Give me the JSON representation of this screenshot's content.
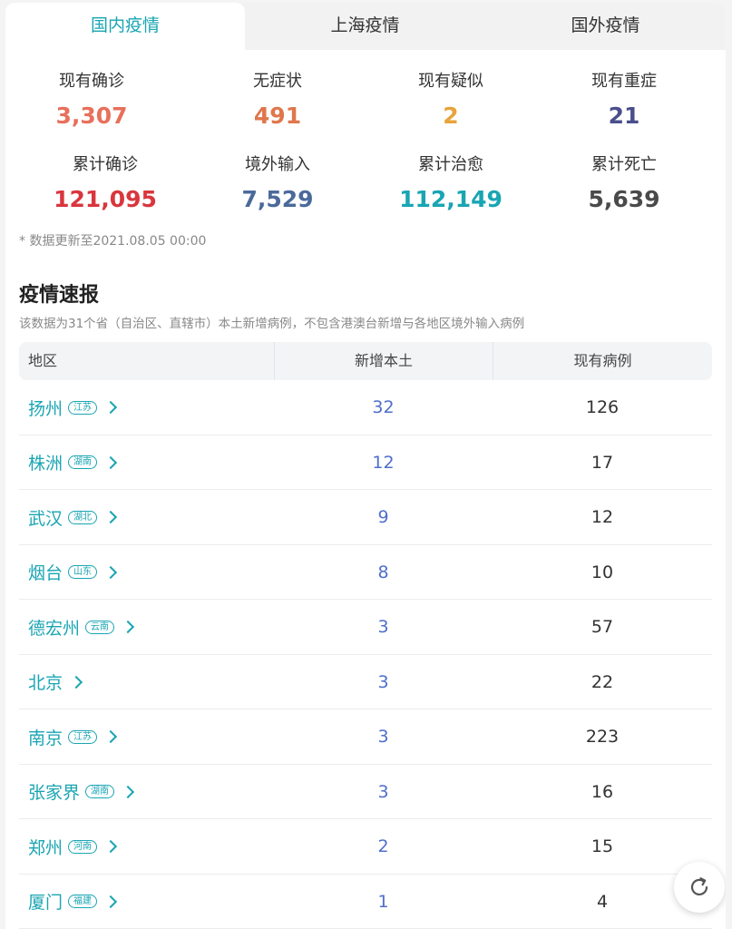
{
  "tabs": [
    {
      "label": "国内疫情",
      "active": true
    },
    {
      "label": "上海疫情",
      "active": false
    },
    {
      "label": "国外疫情",
      "active": false
    }
  ],
  "stats": [
    {
      "label": "现有确诊",
      "value": "3,307",
      "color": "#e8705c"
    },
    {
      "label": "无症状",
      "value": "491",
      "color": "#e0764c"
    },
    {
      "label": "现有疑似",
      "value": "2",
      "color": "#e8a33a"
    },
    {
      "label": "现有重症",
      "value": "21",
      "color": "#4a4f8c"
    },
    {
      "label": "累计确诊",
      "value": "121,095",
      "color": "#d9363e"
    },
    {
      "label": "境外输入",
      "value": "7,529",
      "color": "#4b6a9b"
    },
    {
      "label": "累计治愈",
      "value": "112,149",
      "color": "#1aa5b3"
    },
    {
      "label": "累计死亡",
      "value": "5,639",
      "color": "#4a4a4a"
    }
  ],
  "update_note": "* 数据更新至2021.08.05 00:00",
  "section": {
    "title": "疫情速报",
    "description": "该数据为31个省（自治区、直辖市）本土新增病例，不包含港澳台新增与各地区境外输入病例"
  },
  "table": {
    "headers": {
      "region": "地区",
      "new_local": "新增本土",
      "current": "现有病例"
    },
    "rows": [
      {
        "city": "扬州",
        "province": "江苏",
        "new_local": "32",
        "current": "126"
      },
      {
        "city": "株洲",
        "province": "湖南",
        "new_local": "12",
        "current": "17"
      },
      {
        "city": "武汉",
        "province": "湖北",
        "new_local": "9",
        "current": "12"
      },
      {
        "city": "烟台",
        "province": "山东",
        "new_local": "8",
        "current": "10"
      },
      {
        "city": "德宏州",
        "province": "云南",
        "new_local": "3",
        "current": "57"
      },
      {
        "city": "北京",
        "province": "",
        "new_local": "3",
        "current": "22"
      },
      {
        "city": "南京",
        "province": "江苏",
        "new_local": "3",
        "current": "223"
      },
      {
        "city": "张家界",
        "province": "湖南",
        "new_local": "3",
        "current": "16"
      },
      {
        "city": "郑州",
        "province": "河南",
        "new_local": "2",
        "current": "15"
      },
      {
        "city": "厦门",
        "province": "福建",
        "new_local": "1",
        "current": "4"
      }
    ]
  },
  "icons": {
    "refresh": "refresh-icon",
    "row_arrow": "chevron-right-icon"
  },
  "colors": {
    "accent": "#1aa5b3",
    "new_local_number": "#4f6fcc"
  }
}
